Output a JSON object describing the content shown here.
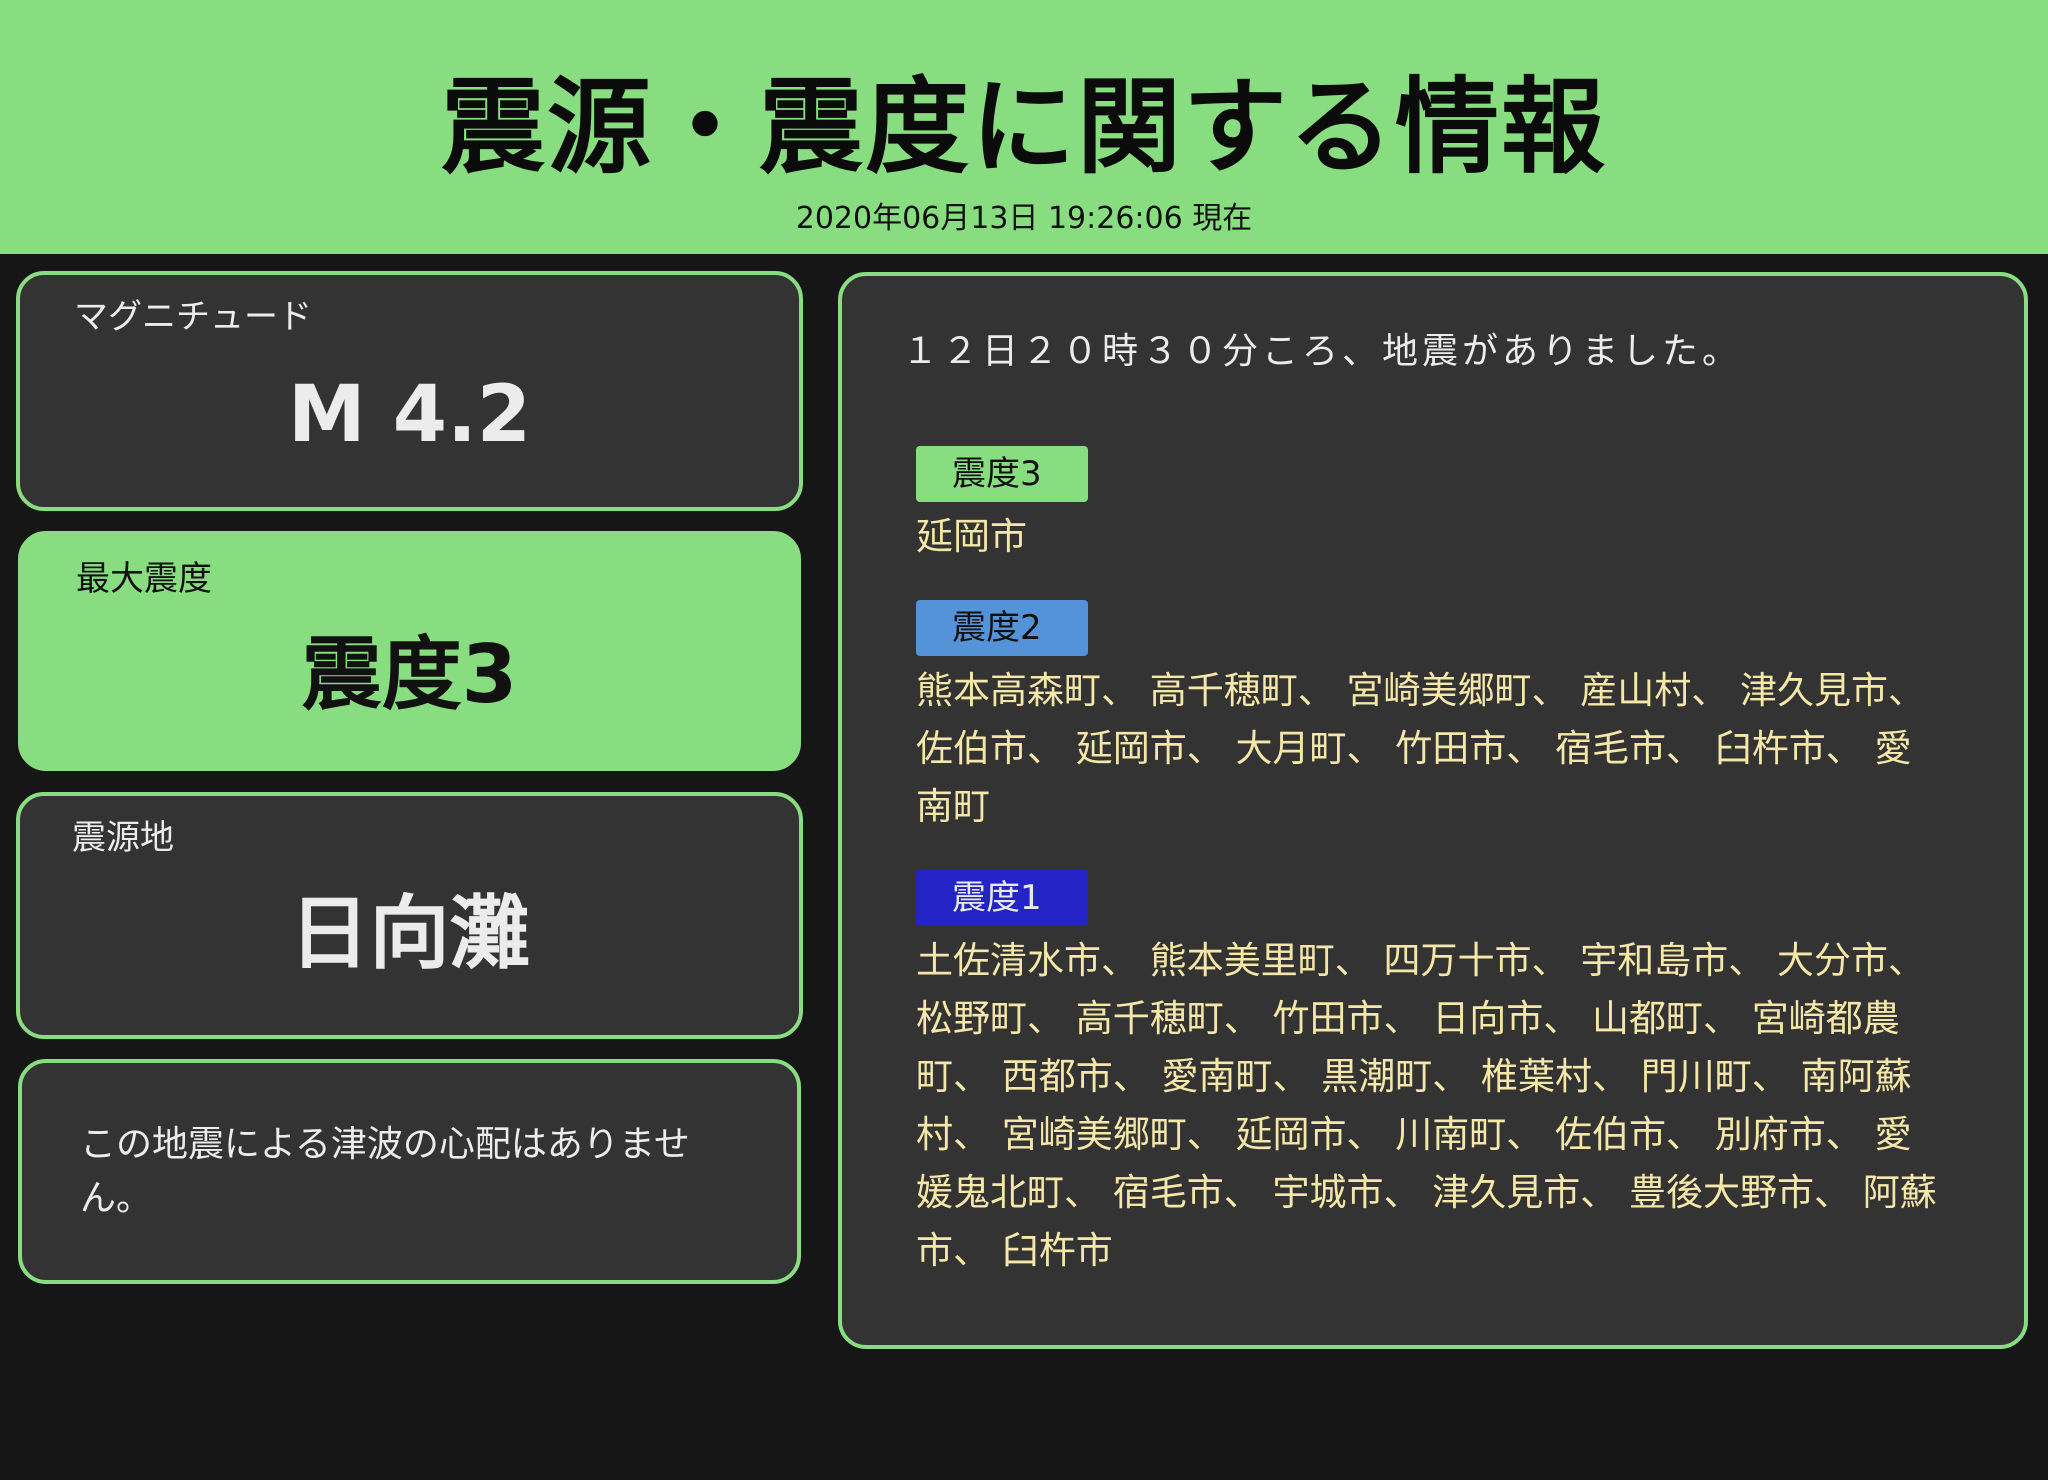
{
  "header": {
    "title": "震源・震度に関する情報",
    "timestamp": "2020年06月13日 19:26:06 現在"
  },
  "magnitude": {
    "label": "マグニチュード",
    "value": "M 4.2"
  },
  "max_intensity": {
    "label": "最大震度",
    "value": "震度3"
  },
  "epicenter": {
    "label": "震源地",
    "value": "日向灘"
  },
  "tsunami": {
    "message": "この地震による津波の心配はありません。"
  },
  "detail": {
    "headline": "１２日２０時３０分ころ、地震がありました。",
    "groups": [
      {
        "badge": "震度3",
        "areas": "延岡市"
      },
      {
        "badge": "震度2",
        "areas": "熊本高森町、 高千穂町、 宮崎美郷町、 産山村、 津久見市、 佐伯市、 延岡市、 大月町、 竹田市、 宿毛市、 臼杵市、 愛南町"
      },
      {
        "badge": "震度1",
        "areas": "土佐清水市、 熊本美里町、 四万十市、 宇和島市、 大分市、 松野町、 高千穂町、 竹田市、 日向市、 山都町、 宮崎都農町、 西都市、 愛南町、 黒潮町、 椎葉村、 門川町、 南阿蘇村、 宮崎美郷町、 延岡市、 川南町、 佐伯市、 別府市、 愛媛鬼北町、 宿毛市、 宇城市、 津久見市、 豊後大野市、 阿蘇市、 臼杵市"
      }
    ]
  },
  "colors": {
    "accent_green": "#88dd80",
    "intensity2_blue": "#5593d8",
    "intensity1_navy": "#2323c6",
    "area_text": "#f5e7a8",
    "card_bg": "#333333",
    "page_bg": "#161616"
  }
}
